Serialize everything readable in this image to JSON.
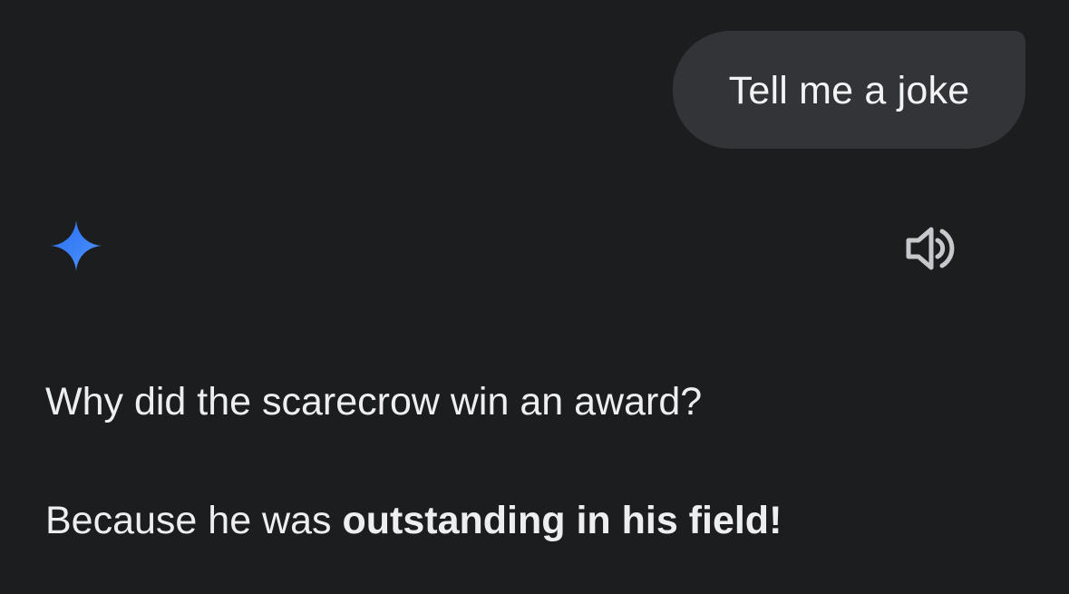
{
  "user_message": {
    "text": "Tell me a joke"
  },
  "assistant": {
    "logo_icon": "sparkle-icon",
    "speaker_icon": "speaker-icon",
    "response": {
      "line1": "Why did the scarecrow win an award?",
      "line2_prefix": "Because he was ",
      "line2_bold": "outstanding in his field!"
    }
  },
  "colors": {
    "background": "#1c1d1f",
    "user_bubble": "#333437",
    "accent_blue": "#3b82f6",
    "text": "#f1f1f3",
    "icon_gray": "#c7c8cc"
  }
}
